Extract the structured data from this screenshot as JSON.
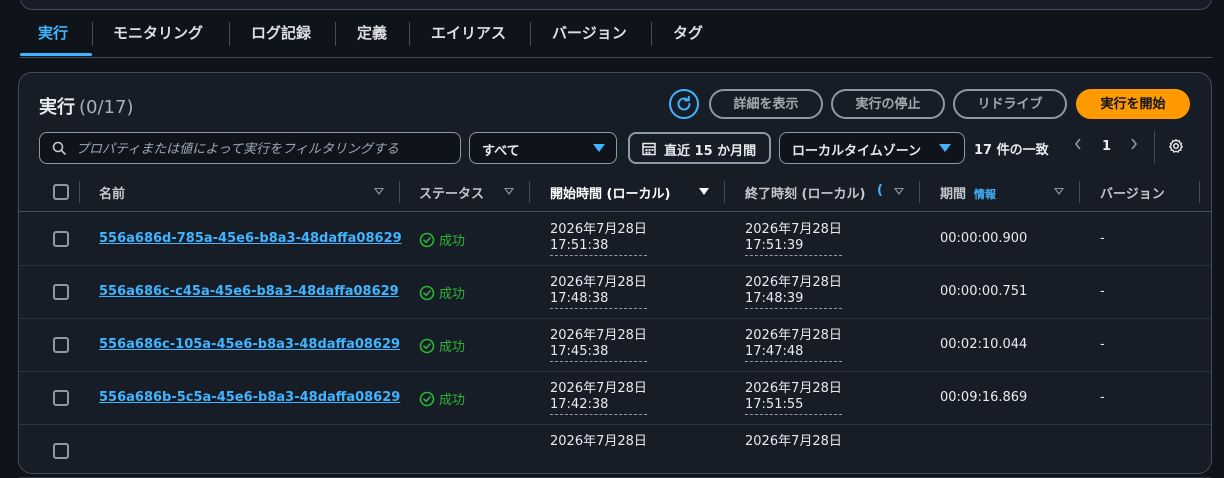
{
  "tabs": [
    {
      "label": "実行",
      "active": true
    },
    {
      "label": "モニタリング"
    },
    {
      "label": "ログ記録"
    },
    {
      "label": "定義"
    },
    {
      "label": "エイリアス"
    },
    {
      "label": "バージョン"
    },
    {
      "label": "タグ"
    }
  ],
  "panel": {
    "title": "実行",
    "count": "(0/17)",
    "buttons": {
      "details": "詳細を表示",
      "stop": "実行の停止",
      "redrive": "リドライブ",
      "start": "実行を開始"
    }
  },
  "filter": {
    "search_placeholder": "プロパティまたは値によって実行をフィルタリングする",
    "status_select": "すべて",
    "date_range": "直近 15 か月間",
    "timezone_select": "ローカルタイムゾーン",
    "match_count": "17 件の一致",
    "page": "1"
  },
  "table": {
    "headers": {
      "name": "名前",
      "status": "ステータス",
      "start": "開始時間 (ローカル)",
      "end": "終了時刻 (ローカル)",
      "duration": "期間",
      "duration_info": "情報",
      "version": "バージョン"
    },
    "rows": [
      {
        "name": "556a686d-785a-45e6-b8a3-48daffa08629",
        "status": "成功",
        "start_date": "2026年7月28日",
        "start_time": "17:51:38",
        "end_date": "2026年7月28日",
        "end_time": "17:51:39",
        "duration": "00:00:00.900",
        "version": "-"
      },
      {
        "name": "556a686c-c45a-45e6-b8a3-48daffa08629",
        "status": "成功",
        "start_date": "2026年7月28日",
        "start_time": "17:48:38",
        "end_date": "2026年7月28日",
        "end_time": "17:48:39",
        "duration": "00:00:00.751",
        "version": "-"
      },
      {
        "name": "556a686c-105a-45e6-b8a3-48daffa08629",
        "status": "成功",
        "start_date": "2026年7月28日",
        "start_time": "17:45:38",
        "end_date": "2026年7月28日",
        "end_time": "17:47:48",
        "duration": "00:02:10.044",
        "version": "-"
      },
      {
        "name": "556a686b-5c5a-45e6-b8a3-48daffa08629",
        "status": "成功",
        "start_date": "2026年7月28日",
        "start_time": "17:42:38",
        "end_date": "2026年7月28日",
        "end_time": "17:51:55",
        "duration": "00:09:16.869",
        "version": "-"
      },
      {
        "name": "",
        "status": "",
        "start_date": "2026年7月28日",
        "start_time": "",
        "end_date": "2026年7月28日",
        "end_time": "",
        "duration": "",
        "version": ""
      }
    ]
  },
  "colors": {
    "accent": "#42b4ff",
    "primary_button": "#ff9900",
    "success": "#2bb534",
    "background": "#0f141a",
    "panel": "#161d26"
  }
}
